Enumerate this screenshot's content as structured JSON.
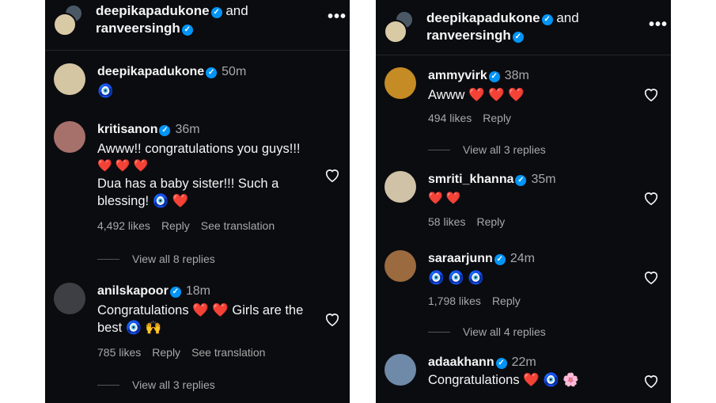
{
  "header": {
    "user1": "deepikapadukone",
    "and": "and",
    "user2": "ranveersingh",
    "more": "•••"
  },
  "left": {
    "caption": {
      "user": "deepikapadukone",
      "time": "50m",
      "text": "🧿"
    },
    "comments": [
      {
        "user": "kritisanon",
        "time": "36m",
        "line1": "Awww!! congratulations you guys!!!",
        "line2": "❤️ ❤️ ❤️",
        "line3": "Dua has a baby sister!!! Such a",
        "line4": "blessing! 🧿 ❤️",
        "likes": "4,492 likes",
        "reply": "Reply",
        "translate": "See translation",
        "replies": "View all 8 replies"
      },
      {
        "user": "anilskapoor",
        "time": "18m",
        "line1": "Congratulations ❤️ ❤️ Girls are the",
        "line2": "best 🧿 🙌",
        "likes": "785 likes",
        "reply": "Reply",
        "translate": "See translation",
        "replies": "View all 3 replies"
      }
    ]
  },
  "right": {
    "comments": [
      {
        "user": "ammyvirk",
        "time": "38m",
        "text": "Awww ❤️ ❤️ ❤️",
        "likes": "494 likes",
        "reply": "Reply",
        "replies": "View all 3 replies"
      },
      {
        "user": "smriti_khanna",
        "time": "35m",
        "text": "❤️ ❤️",
        "likes": "58 likes",
        "reply": "Reply"
      },
      {
        "user": "saraarjunn",
        "time": "24m",
        "text": "🧿 🧿 🧿",
        "likes": "1,798 likes",
        "reply": "Reply",
        "replies": "View all 4 replies"
      },
      {
        "user": "adaakhann",
        "time": "22m",
        "text": "Congratulations ❤️ 🧿 🌸"
      }
    ]
  },
  "colors": {
    "background": "#0b0c10",
    "verified": "#0095f6",
    "heart": "#ff3a6e",
    "muted": "#a8a8a8"
  }
}
